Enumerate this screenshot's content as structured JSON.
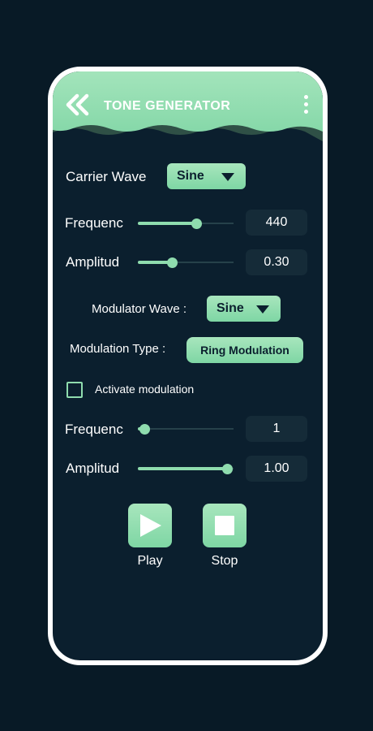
{
  "header": {
    "title": "TONE GENERATOR",
    "back_icon": "double-chevron-left-icon",
    "menu_icon": "vertical-dots-icon",
    "color": "#8fdcae"
  },
  "carrier": {
    "wave_label": "Carrier Wave",
    "wave_value": "Sine",
    "frequency_label": "Frequenc",
    "frequency_value": "440",
    "frequency_level": 0.61,
    "amplitude_label": "Amplitud",
    "amplitude_value": "0.30",
    "amplitude_level": 0.36
  },
  "modulator": {
    "wave_label": "Modulator Wave :",
    "wave_value": "Sine",
    "type_label": "Modulation Type :",
    "type_value": "Ring Modulation",
    "activate_label": "Activate modulation",
    "activate_checked": false,
    "frequency_label": "Frequenc",
    "frequency_value": "1",
    "frequency_level": 0.07,
    "amplitude_label": "Amplitud",
    "amplitude_value": "1.00",
    "amplitude_level": 0.93
  },
  "controls": {
    "play_label": "Play",
    "stop_label": "Stop",
    "play_icon": "play-icon",
    "stop_icon": "stop-icon"
  },
  "colors": {
    "background": "#081a26",
    "panel": "#0b1f2e",
    "accent": "#8fdcae",
    "value_box": "#152b38"
  }
}
